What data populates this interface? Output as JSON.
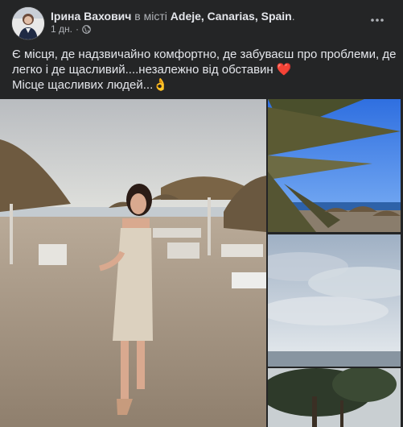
{
  "post": {
    "author": "Ірина Вахович",
    "location_prefix": "в місті",
    "location": "Adeje, Canarias, Spain",
    "location_suffix": ".",
    "timestamp": "1 дн.",
    "separator": "·",
    "privacy_icon": "globe-icon",
    "more_icon": "more-options-icon",
    "text_line1": "Є місця, де надзвичайно комфортно, де забуваєш про проблеми, де",
    "text_line2": "легко і де щасливий....незалежно від обставин ❤️",
    "text_line3": "Місце щасливих людей...👌"
  },
  "gallery": {
    "photos": [
      {
        "name": "beach-woman-photo"
      },
      {
        "name": "palm-sky-photo"
      },
      {
        "name": "cloudy-sky-photo"
      },
      {
        "name": "tree-photo"
      }
    ]
  },
  "colors": {
    "background": "#242526",
    "text": "#e4e6eb",
    "muted": "#b0b3b8"
  }
}
